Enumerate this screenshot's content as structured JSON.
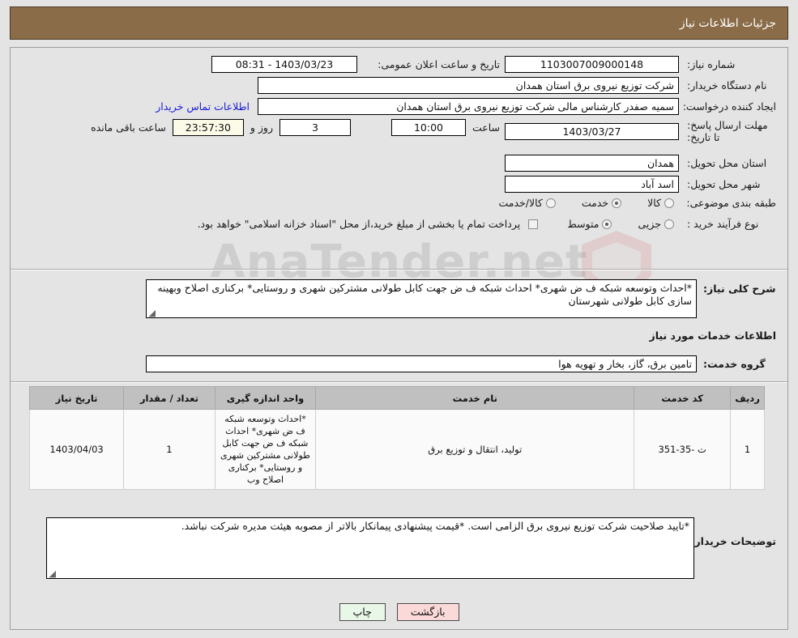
{
  "header": {
    "title": "جزئیات اطلاعات نیاز"
  },
  "info": {
    "need_number_label": "شماره نیاز:",
    "need_number_value": "1103007009000148",
    "buyer_org_label": "نام دستگاه خریدار:",
    "buyer_org_value": "شرکت توزیع نیروی برق استان همدان",
    "requester_label": "ایجاد کننده درخواست:",
    "requester_value": "سمیه صفدر کارشناس مالی شرکت توزیع نیروی برق استان همدان",
    "deadline_label": "مهلت ارسال پاسخ: تا تاریخ:",
    "deadline_date": "1403/03/27",
    "province_label": "استان محل تحویل:",
    "province_value": "همدان",
    "city_label": "شهر محل تحویل:",
    "city_value": "اسد آباد",
    "public_announce_label": "تاریخ و ساعت اعلان عمومی:",
    "public_announce_value": "1403/03/23 - 08:31",
    "contact_link": "اطلاعات تماس خریدار",
    "hour_label": "ساعت",
    "hour_value": "10:00",
    "days_value": "3",
    "days_unit": "روز و",
    "countdown_value": "23:57:30",
    "countdown_suffix": "ساعت باقی مانده",
    "category_label": "طبقه بندی موضوعی:",
    "category_options": [
      {
        "label": "کالا",
        "selected": false
      },
      {
        "label": "خدمت",
        "selected": true
      },
      {
        "label": "کالا/خدمت",
        "selected": false
      }
    ],
    "purchase_type_label": "نوع فرآیند خرید :",
    "purchase_type_options": [
      {
        "label": "جزیی",
        "selected": false
      },
      {
        "label": "متوسط",
        "selected": true
      }
    ],
    "treasury_checkbox_text": "پرداخت تمام یا بخشی از مبلغ خرید،از محل \"اسناد خزانه اسلامی\" خواهد بود.",
    "treasury_checked": false
  },
  "description": {
    "label": "شرح کلی نیاز:",
    "text": "*احداث وتوسعه شبکه ف ض شهری* احداث شبکه ف ض جهت کابل طولانی مشترکین شهری و روستایی* برکناری اصلاح وبهینه سازی کابل طولانی شهرستان"
  },
  "services_section": {
    "heading": "اطلاعات خدمات مورد نیاز",
    "group_label": "گروه خدمت:",
    "group_value": "تامین برق، گاز، بخار و تهویه هوا"
  },
  "table": {
    "headers": [
      "ردیف",
      "کد خدمت",
      "نام خدمت",
      "واحد اندازه گیری",
      "تعداد / مقدار",
      "تاریخ نیاز"
    ],
    "rows": [
      {
        "index": "1",
        "service_code": "ت -35-351",
        "service_name": "تولید، انتقال و توزیع برق",
        "unit": "*احداث وتوسعه شبکه ف ض شهری* احداث شبکه ف ض جهت کابل طولانی مشترکین شهری و روستایی* برکناری اصلاح وب",
        "quantity": "1",
        "need_date": "1403/04/03"
      }
    ]
  },
  "buyer_notes": {
    "label": "توضیحات خریدار:",
    "text": "*تایید صلاحیت شرکت توزیع نیروی برق الزامی است. *قیمت پیشنهادی پیمانکار بالاتر از مصوبه هیئت مدیره شرکت نباشد."
  },
  "footer": {
    "print_label": "چاپ",
    "back_label": "بازگشت"
  },
  "watermark": {
    "text": "AnaTender.net"
  },
  "colors": {
    "header_bg": "#8a6d48",
    "page_bg": "#e4e4e4",
    "link": "#1b1bd6",
    "table_header_bg": "#c0c0c0",
    "print_btn_bg": "#e8f7e8",
    "back_btn_bg": "#fcd9d9",
    "countdown_bg": "#fcfbe8"
  }
}
